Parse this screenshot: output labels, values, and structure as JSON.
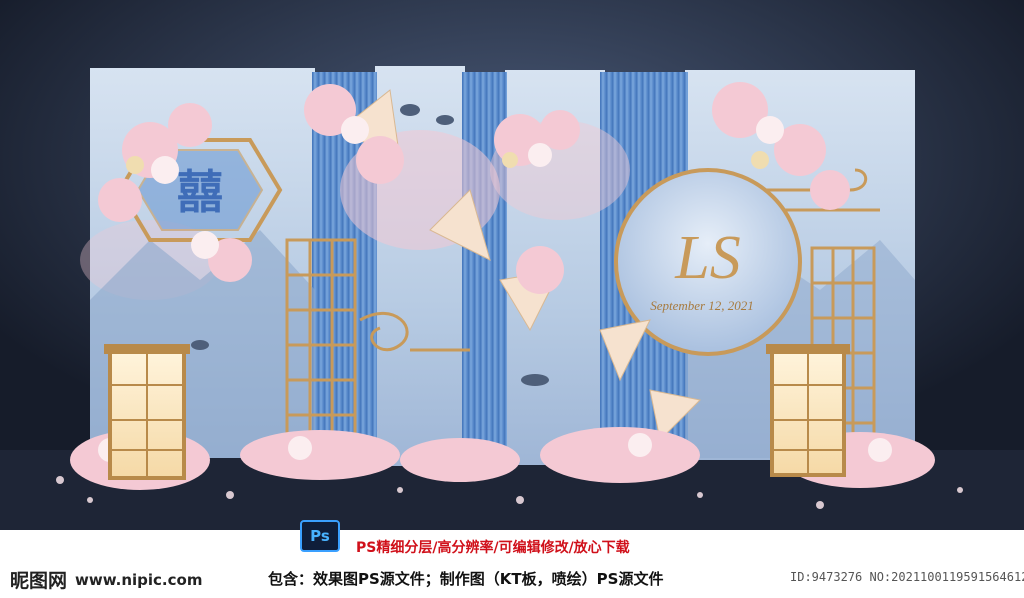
{
  "colors": {
    "backdrop_blue": "#5b8fd4",
    "panel_light": "#c9d9ec",
    "blush": "#f2c9d3",
    "gold": "#c89a5a",
    "stage_dark": "#1b2233",
    "promo_red": "#d0101a"
  },
  "monogram": {
    "initials": "LS",
    "date": "September 12, 2021"
  },
  "software_badge": {
    "label": "Ps",
    "icon": "photoshop-icon"
  },
  "promo_text": "PS精细分层/高分辨率/可编辑修改/放心下载",
  "contents_text": "包含：效果图PS源文件；制作图（KT板，喷绘）PS源文件",
  "watermark": {
    "site_name": "昵图网",
    "url": "www.nipic.com"
  },
  "image_id": "ID:9473276 NO:20211001195915646120"
}
